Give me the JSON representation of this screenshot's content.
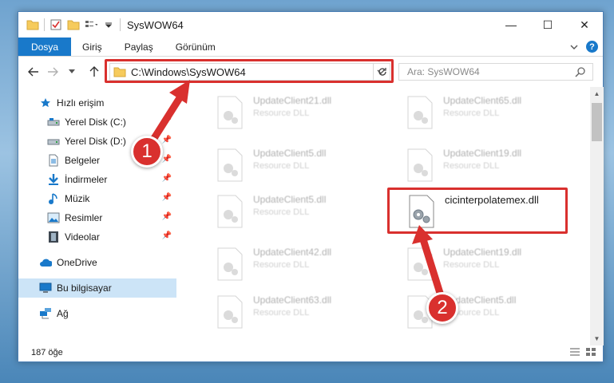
{
  "window": {
    "title": "SysWOW64",
    "controls": {
      "minimize": "—",
      "maximize": "☐",
      "close": "✕"
    }
  },
  "ribbon": {
    "tabs": [
      "Dosya",
      "Giriş",
      "Paylaş",
      "Görünüm"
    ],
    "help": "?"
  },
  "address": {
    "path": "C:\\Windows\\SysWOW64"
  },
  "search": {
    "placeholder": "Ara: SysWOW64"
  },
  "sidebar": {
    "items": [
      {
        "label": "Hızlı erişim",
        "icon": "star-icon"
      },
      {
        "label": "Yerel Disk (C:)",
        "icon": "drive-icon"
      },
      {
        "label": "Yerel Disk (D:)",
        "icon": "drive-icon"
      },
      {
        "label": "Belgeler",
        "icon": "documents-icon"
      },
      {
        "label": "İndirmeler",
        "icon": "download-icon"
      },
      {
        "label": "Müzik",
        "icon": "music-icon"
      },
      {
        "label": "Resimler",
        "icon": "pictures-icon"
      },
      {
        "label": "Videolar",
        "icon": "videos-icon"
      },
      {
        "label": "OneDrive",
        "icon": "cloud-icon"
      },
      {
        "label": "Bu bilgisayar",
        "icon": "computer-icon"
      },
      {
        "label": "Ağ",
        "icon": "network-icon"
      }
    ]
  },
  "files": [
    {
      "name": "UpdateClient21.dll",
      "type": "Resource DLL"
    },
    {
      "name": "UpdateClient65.dll",
      "type": "Resource DLL"
    },
    {
      "name": "UpdateClient5.dll",
      "type": "Resource DLL"
    },
    {
      "name": "UpdateClient19.dll",
      "type": "Resource DLL"
    },
    {
      "name": "UpdateClient5.dll",
      "type": "Resource DLL"
    },
    {
      "name": "cicinterpolatemex.dll",
      "type": ""
    },
    {
      "name": "UpdateClient42.dll",
      "type": "Resource DLL"
    },
    {
      "name": "UpdateClient19.dll",
      "type": "Resource DLL"
    },
    {
      "name": "UpdateClient63.dll",
      "type": "Resource DLL"
    },
    {
      "name": "UpdateClient5.dll",
      "type": "Resource DLL"
    }
  ],
  "status": {
    "count": "187 öğe"
  },
  "callouts": [
    "1",
    "2"
  ],
  "colors": {
    "accent": "#1979ca",
    "highlight": "#d9302e",
    "selected": "#cce4f7"
  }
}
